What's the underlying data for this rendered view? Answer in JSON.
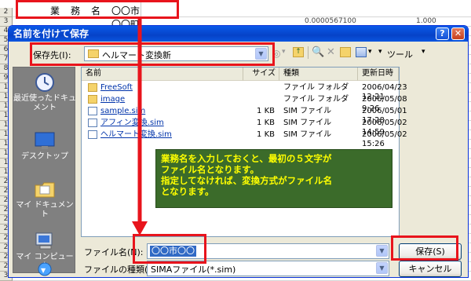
{
  "sheet": {
    "rows": [
      "2",
      "3",
      "4",
      "5",
      "6",
      "7",
      "8",
      "9",
      "1",
      "1",
      "1",
      "1",
      "1",
      "1",
      "1",
      "1",
      "1",
      "1",
      "2",
      "2",
      "2",
      "2",
      "2",
      "2",
      "2",
      "2",
      "2",
      "2",
      "3"
    ],
    "title_label": "業　務　名",
    "title_value": "〇〇市〇〇町",
    "peek_number": "0.0000567100",
    "peek_value": "1.000"
  },
  "dialog": {
    "title": "名前を付けて保存",
    "help_glyph": "?",
    "close_glyph": "✕",
    "save_in_label": "保存先(I):",
    "save_in_value": "ヘルマート変換新",
    "tools_label": "ツール",
    "places": [
      "最近使ったドキュメント",
      "デスクトップ",
      "マイ ドキュメント",
      "マイ コンピュータ"
    ],
    "columns": {
      "name": "名前",
      "size": "サイズ",
      "type": "種類",
      "date": "更新日時"
    },
    "files": [
      {
        "name": "FreeSoft",
        "size": "",
        "type": "ファイル フォルダ",
        "date": "2006/04/23 12:21",
        "kind": "folder"
      },
      {
        "name": "image",
        "size": "",
        "type": "ファイル フォルダ",
        "date": "2006/05/08 9:26",
        "kind": "folder"
      },
      {
        "name": "sample.sim",
        "size": "1 KB",
        "type": "SIM ファイル",
        "date": "2006/05/01 17:28",
        "kind": "file"
      },
      {
        "name": "アフィン変換.sim",
        "size": "1 KB",
        "type": "SIM ファイル",
        "date": "2006/05/02 14:59",
        "kind": "file"
      },
      {
        "name": "ヘルマート変換.sim",
        "size": "1 KB",
        "type": "SIM ファイル",
        "date": "2006/05/02 15:26",
        "kind": "file"
      }
    ],
    "filename_label": "ファイル名(N):",
    "filename_value": "〇〇市〇〇",
    "filetype_label": "ファイルの種類(T):",
    "filetype_value": "SIMAファイル(*.sim)",
    "save_button": "保存(S)",
    "cancel_button": "キャンセル"
  },
  "note": {
    "lines": [
      "業務名を入力しておくと、最初の５文字が",
      "ファイル名となります。",
      "指定してなければ、変換方式がファイル名",
      "となります。"
    ]
  },
  "colors": {
    "highlight": "#e8141c",
    "note_bg": "#3b6b2a",
    "note_text": "#ffff00",
    "title_blue": "#0642c8"
  }
}
